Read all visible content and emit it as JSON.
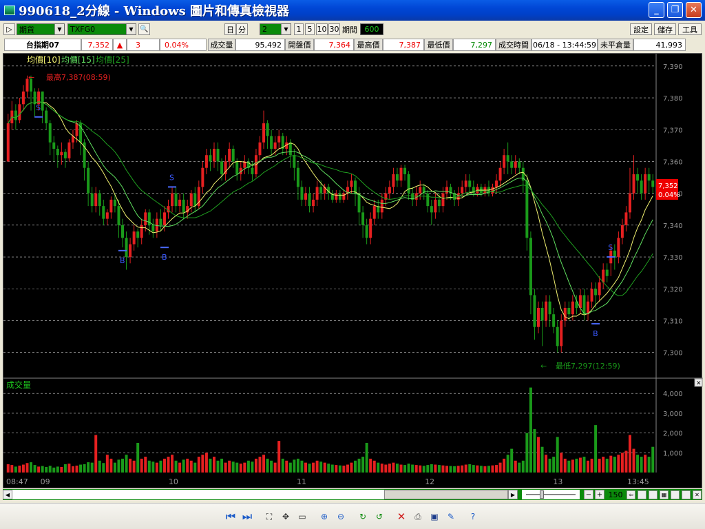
{
  "window": {
    "title": "990618_2分線 - Windows 圖片和傳真檢視器",
    "buttons": [
      "_",
      "❐",
      "✕"
    ]
  },
  "toolbar": {
    "play_icon": "▷",
    "market_type": "期貨",
    "symbol": "TXFG0",
    "period_day": "日",
    "period_minute": "分",
    "minute_value": "2",
    "quick_periods": [
      "1",
      "5",
      "10",
      "30"
    ],
    "span_label": "期間",
    "span_value": "600",
    "settings": "設定",
    "save": "儲存",
    "tools": "工具"
  },
  "quote": {
    "name": "台指期07",
    "price": "7,352",
    "change_arrow": "▲",
    "change": "3",
    "change_pct": "0.04%",
    "volume_label": "成交量",
    "volume": "95,492",
    "open_label": "開盤價",
    "open": "7,364",
    "high_label": "最高價",
    "high": "7,387",
    "low_label": "最低價",
    "low": "7,297",
    "time_label": "成交時間",
    "time": "06/18 - 13:44:59",
    "oi_label": "未平倉量",
    "oi": "41,993"
  },
  "legend": {
    "ma10": "均價[10]",
    "ma15": "均價[15]",
    "ma25": "均價[25]"
  },
  "annotations": {
    "high": "最高7,387(08:59)",
    "low": "最低7,297(12:59)",
    "current_price": "7,352",
    "current_pct": "0.04%"
  },
  "volume_panel": {
    "title": "成交量"
  },
  "scroll": {
    "zoom_value": "150"
  },
  "colors": {
    "up": "#e52020",
    "down": "#1a9a1a",
    "ma10": "#f0f070",
    "ma15": "#60e060",
    "ma25": "#20a020",
    "grid": "#d0d0d0",
    "axis_text": "#9a9a9a"
  },
  "chart_data": {
    "type": "candlestick",
    "x_ticks": [
      "08:47",
      "09",
      "10",
      "11",
      "12",
      "13",
      "13:45"
    ],
    "price_ticks": [
      7390,
      7380,
      7370,
      7360,
      7350,
      7340,
      7330,
      7320,
      7310,
      7300
    ],
    "price_ylim": [
      7293,
      7393
    ],
    "volume_ticks": [
      "4,000",
      "3,000",
      "2,000",
      "1,000"
    ],
    "volume_ylim": [
      0,
      4600
    ],
    "signals": [
      {
        "label": "S",
        "index": 8,
        "price": 7374
      },
      {
        "label": "B",
        "index": 30,
        "price": 7332
      },
      {
        "label": "B",
        "index": 41,
        "price": 7333
      },
      {
        "label": "S",
        "index": 43,
        "price": 7352
      },
      {
        "label": "B",
        "index": 154,
        "price": 7309
      },
      {
        "label": "S",
        "index": 158,
        "price": 7330
      }
    ],
    "bars": [
      [
        7360,
        7372,
        7362,
        7375,
        420
      ],
      [
        7372,
        7376,
        7370,
        7379,
        380
      ],
      [
        7376,
        7373,
        7370,
        7378,
        300
      ],
      [
        7373,
        7378,
        7372,
        7380,
        350
      ],
      [
        7378,
        7382,
        7376,
        7384,
        400
      ],
      [
        7382,
        7386,
        7380,
        7387,
        480
      ],
      [
        7386,
        7382,
        7376,
        7387,
        520
      ],
      [
        7382,
        7378,
        7374,
        7383,
        380
      ],
      [
        7378,
        7382,
        7376,
        7383,
        300
      ],
      [
        7382,
        7376,
        7372,
        7382,
        330
      ],
      [
        7376,
        7372,
        7370,
        7377,
        280
      ],
      [
        7372,
        7366,
        7362,
        7373,
        340
      ],
      [
        7366,
        7364,
        7360,
        7368,
        250
      ],
      [
        7364,
        7362,
        7358,
        7365,
        300
      ],
      [
        7362,
        7363,
        7359,
        7366,
        280
      ],
      [
        7363,
        7361,
        7358,
        7364,
        420
      ],
      [
        7361,
        7366,
        7360,
        7367,
        450
      ],
      [
        7366,
        7368,
        7364,
        7370,
        320
      ],
      [
        7368,
        7372,
        7366,
        7373,
        350
      ],
      [
        7372,
        7366,
        7362,
        7373,
        400
      ],
      [
        7366,
        7358,
        7354,
        7367,
        420
      ],
      [
        7358,
        7350,
        7346,
        7360,
        520
      ],
      [
        7350,
        7346,
        7344,
        7352,
        500
      ],
      [
        7346,
        7350,
        7344,
        7352,
        1900
      ],
      [
        7350,
        7346,
        7343,
        7351,
        600
      ],
      [
        7346,
        7342,
        7340,
        7348,
        480
      ],
      [
        7342,
        7344,
        7340,
        7345,
        900
      ],
      [
        7344,
        7348,
        7342,
        7349,
        700
      ],
      [
        7348,
        7346,
        7344,
        7350,
        500
      ],
      [
        7346,
        7340,
        7336,
        7348,
        650
      ],
      [
        7340,
        7336,
        7333,
        7342,
        700
      ],
      [
        7336,
        7330,
        7326,
        7338,
        900
      ],
      [
        7330,
        7334,
        7328,
        7336,
        700
      ],
      [
        7334,
        7338,
        7332,
        7340,
        600
      ],
      [
        7338,
        7336,
        7333,
        7339,
        1500
      ],
      [
        7336,
        7340,
        7334,
        7342,
        700
      ],
      [
        7340,
        7344,
        7338,
        7345,
        800
      ],
      [
        7344,
        7340,
        7337,
        7345,
        600
      ],
      [
        7340,
        7338,
        7336,
        7342,
        550
      ],
      [
        7338,
        7342,
        7336,
        7344,
        500
      ],
      [
        7342,
        7340,
        7338,
        7345,
        600
      ],
      [
        7340,
        7344,
        7338,
        7346,
        700
      ],
      [
        7344,
        7346,
        7342,
        7348,
        800
      ],
      [
        7346,
        7350,
        7344,
        7352,
        900
      ],
      [
        7350,
        7346,
        7344,
        7352,
        600
      ],
      [
        7346,
        7348,
        7344,
        7350,
        500
      ],
      [
        7348,
        7344,
        7342,
        7350,
        650
      ],
      [
        7344,
        7346,
        7342,
        7348,
        700
      ],
      [
        7346,
        7350,
        7344,
        7351,
        600
      ],
      [
        7350,
        7346,
        7344,
        7352,
        500
      ],
      [
        7346,
        7352,
        7345,
        7354,
        800
      ],
      [
        7352,
        7358,
        7350,
        7360,
        900
      ],
      [
        7358,
        7362,
        7356,
        7364,
        1000
      ],
      [
        7362,
        7360,
        7357,
        7364,
        700
      ],
      [
        7360,
        7364,
        7358,
        7366,
        800
      ],
      [
        7364,
        7360,
        7357,
        7366,
        600
      ],
      [
        7360,
        7356,
        7354,
        7361,
        700
      ],
      [
        7356,
        7360,
        7354,
        7362,
        500
      ],
      [
        7360,
        7364,
        7358,
        7366,
        600
      ],
      [
        7364,
        7360,
        7358,
        7365,
        550
      ],
      [
        7360,
        7356,
        7354,
        7361,
        500
      ],
      [
        7356,
        7358,
        7354,
        7360,
        450
      ],
      [
        7358,
        7360,
        7356,
        7362,
        500
      ],
      [
        7360,
        7358,
        7356,
        7361,
        600
      ],
      [
        7358,
        7356,
        7354,
        7360,
        550
      ],
      [
        7356,
        7362,
        7355,
        7364,
        700
      ],
      [
        7362,
        7366,
        7360,
        7368,
        800
      ],
      [
        7366,
        7372,
        7364,
        7376,
        900
      ],
      [
        7372,
        7368,
        7364,
        7373,
        700
      ],
      [
        7368,
        7364,
        7362,
        7370,
        600
      ],
      [
        7364,
        7366,
        7362,
        7368,
        500
      ],
      [
        7366,
        7368,
        7364,
        7370,
        1600
      ],
      [
        7368,
        7364,
        7362,
        7369,
        700
      ],
      [
        7364,
        7366,
        7362,
        7368,
        600
      ],
      [
        7366,
        7362,
        7358,
        7367,
        500
      ],
      [
        7362,
        7358,
        7354,
        7364,
        650
      ],
      [
        7358,
        7352,
        7348,
        7360,
        700
      ],
      [
        7352,
        7348,
        7346,
        7354,
        600
      ],
      [
        7348,
        7350,
        7346,
        7352,
        500
      ],
      [
        7350,
        7346,
        7344,
        7352,
        450
      ],
      [
        7346,
        7348,
        7344,
        7350,
        500
      ],
      [
        7348,
        7352,
        7346,
        7354,
        600
      ],
      [
        7352,
        7350,
        7348,
        7354,
        550
      ],
      [
        7350,
        7352,
        7348,
        7353,
        500
      ],
      [
        7352,
        7350,
        7348,
        7353,
        450
      ],
      [
        7350,
        7348,
        7347,
        7351,
        400
      ],
      [
        7348,
        7350,
        7347,
        7351,
        380
      ],
      [
        7350,
        7348,
        7347,
        7351,
        360
      ],
      [
        7348,
        7350,
        7347,
        7351,
        350
      ],
      [
        7350,
        7352,
        7348,
        7354,
        400
      ],
      [
        7352,
        7354,
        7350,
        7356,
        500
      ],
      [
        7354,
        7350,
        7346,
        7355,
        600
      ],
      [
        7350,
        7344,
        7340,
        7352,
        700
      ],
      [
        7344,
        7340,
        7336,
        7346,
        800
      ],
      [
        7340,
        7336,
        7334,
        7342,
        1500
      ],
      [
        7336,
        7342,
        7334,
        7344,
        700
      ],
      [
        7342,
        7346,
        7340,
        7348,
        600
      ],
      [
        7346,
        7344,
        7342,
        7348,
        500
      ],
      [
        7344,
        7348,
        7342,
        7350,
        450
      ],
      [
        7348,
        7350,
        7346,
        7352,
        400
      ],
      [
        7350,
        7352,
        7348,
        7354,
        450
      ],
      [
        7352,
        7356,
        7350,
        7358,
        500
      ],
      [
        7356,
        7354,
        7352,
        7358,
        450
      ],
      [
        7354,
        7358,
        7352,
        7359,
        400
      ],
      [
        7358,
        7356,
        7354,
        7359,
        380
      ],
      [
        7356,
        7350,
        7348,
        7357,
        450
      ],
      [
        7350,
        7348,
        7346,
        7352,
        400
      ],
      [
        7348,
        7350,
        7346,
        7352,
        380
      ],
      [
        7350,
        7352,
        7348,
        7354,
        360
      ],
      [
        7352,
        7350,
        7348,
        7353,
        340
      ],
      [
        7350,
        7346,
        7344,
        7351,
        380
      ],
      [
        7346,
        7344,
        7340,
        7348,
        420
      ],
      [
        7344,
        7348,
        7342,
        7350,
        400
      ],
      [
        7348,
        7346,
        7344,
        7350,
        380
      ],
      [
        7346,
        7350,
        7344,
        7352,
        360
      ],
      [
        7350,
        7352,
        7348,
        7354,
        340
      ],
      [
        7352,
        7350,
        7348,
        7353,
        330
      ],
      [
        7350,
        7348,
        7346,
        7351,
        320
      ],
      [
        7348,
        7350,
        7346,
        7352,
        340
      ],
      [
        7350,
        7352,
        7349,
        7354,
        360
      ],
      [
        7352,
        7354,
        7350,
        7356,
        400
      ],
      [
        7354,
        7352,
        7350,
        7356,
        420
      ],
      [
        7352,
        7350,
        7349,
        7354,
        380
      ],
      [
        7350,
        7352,
        7349,
        7353,
        360
      ],
      [
        7352,
        7350,
        7349,
        7353,
        340
      ],
      [
        7350,
        7352,
        7349,
        7353,
        320
      ],
      [
        7352,
        7350,
        7349,
        7354,
        340
      ],
      [
        7350,
        7352,
        7349,
        7353,
        360
      ],
      [
        7352,
        7354,
        7350,
        7356,
        380
      ],
      [
        7354,
        7358,
        7352,
        7360,
        500
      ],
      [
        7358,
        7362,
        7356,
        7364,
        700
      ],
      [
        7362,
        7360,
        7356,
        7366,
        900
      ],
      [
        7360,
        7358,
        7356,
        7362,
        1200
      ],
      [
        7358,
        7360,
        7356,
        7362,
        600
      ],
      [
        7360,
        7358,
        7356,
        7361,
        500
      ],
      [
        7358,
        7354,
        7350,
        7360,
        600
      ],
      [
        7354,
        7336,
        7332,
        7356,
        2000
      ],
      [
        7336,
        7318,
        7312,
        7338,
        4300
      ],
      [
        7318,
        7308,
        7304,
        7320,
        2200
      ],
      [
        7308,
        7314,
        7306,
        7316,
        1800
      ],
      [
        7314,
        7310,
        7302,
        7316,
        1300
      ],
      [
        7310,
        7316,
        7308,
        7318,
        900
      ],
      [
        7316,
        7312,
        7308,
        7318,
        700
      ],
      [
        7312,
        7308,
        7306,
        7314,
        800
      ],
      [
        7308,
        7302,
        7300,
        7310,
        1800
      ],
      [
        7302,
        7310,
        7300,
        7312,
        1000
      ],
      [
        7310,
        7314,
        7308,
        7316,
        700
      ],
      [
        7314,
        7312,
        7310,
        7316,
        600
      ],
      [
        7312,
        7316,
        7310,
        7318,
        650
      ],
      [
        7316,
        7314,
        7312,
        7318,
        700
      ],
      [
        7314,
        7318,
        7312,
        7320,
        750
      ],
      [
        7318,
        7312,
        7310,
        7320,
        800
      ],
      [
        7312,
        7316,
        7310,
        7318,
        600
      ],
      [
        7316,
        7320,
        7314,
        7322,
        700
      ],
      [
        7320,
        7318,
        7314,
        7322,
        2400
      ],
      [
        7318,
        7322,
        7316,
        7324,
        700
      ],
      [
        7322,
        7326,
        7320,
        7328,
        800
      ],
      [
        7326,
        7324,
        7322,
        7328,
        700
      ],
      [
        7328,
        7332,
        7324,
        7334,
        850
      ],
      [
        7332,
        7330,
        7326,
        7334,
        800
      ],
      [
        7330,
        7336,
        7328,
        7338,
        900
      ],
      [
        7336,
        7340,
        7334,
        7342,
        1000
      ],
      [
        7340,
        7344,
        7338,
        7346,
        1100
      ],
      [
        7344,
        7350,
        7342,
        7358,
        1900
      ],
      [
        7350,
        7356,
        7348,
        7362,
        1200
      ],
      [
        7356,
        7354,
        7350,
        7358,
        900
      ],
      [
        7354,
        7350,
        7348,
        7356,
        800
      ],
      [
        7350,
        7356,
        7348,
        7358,
        900
      ],
      [
        7356,
        7354,
        7350,
        7358,
        800
      ],
      [
        7354,
        7352,
        7350,
        7356,
        1300
      ]
    ]
  }
}
